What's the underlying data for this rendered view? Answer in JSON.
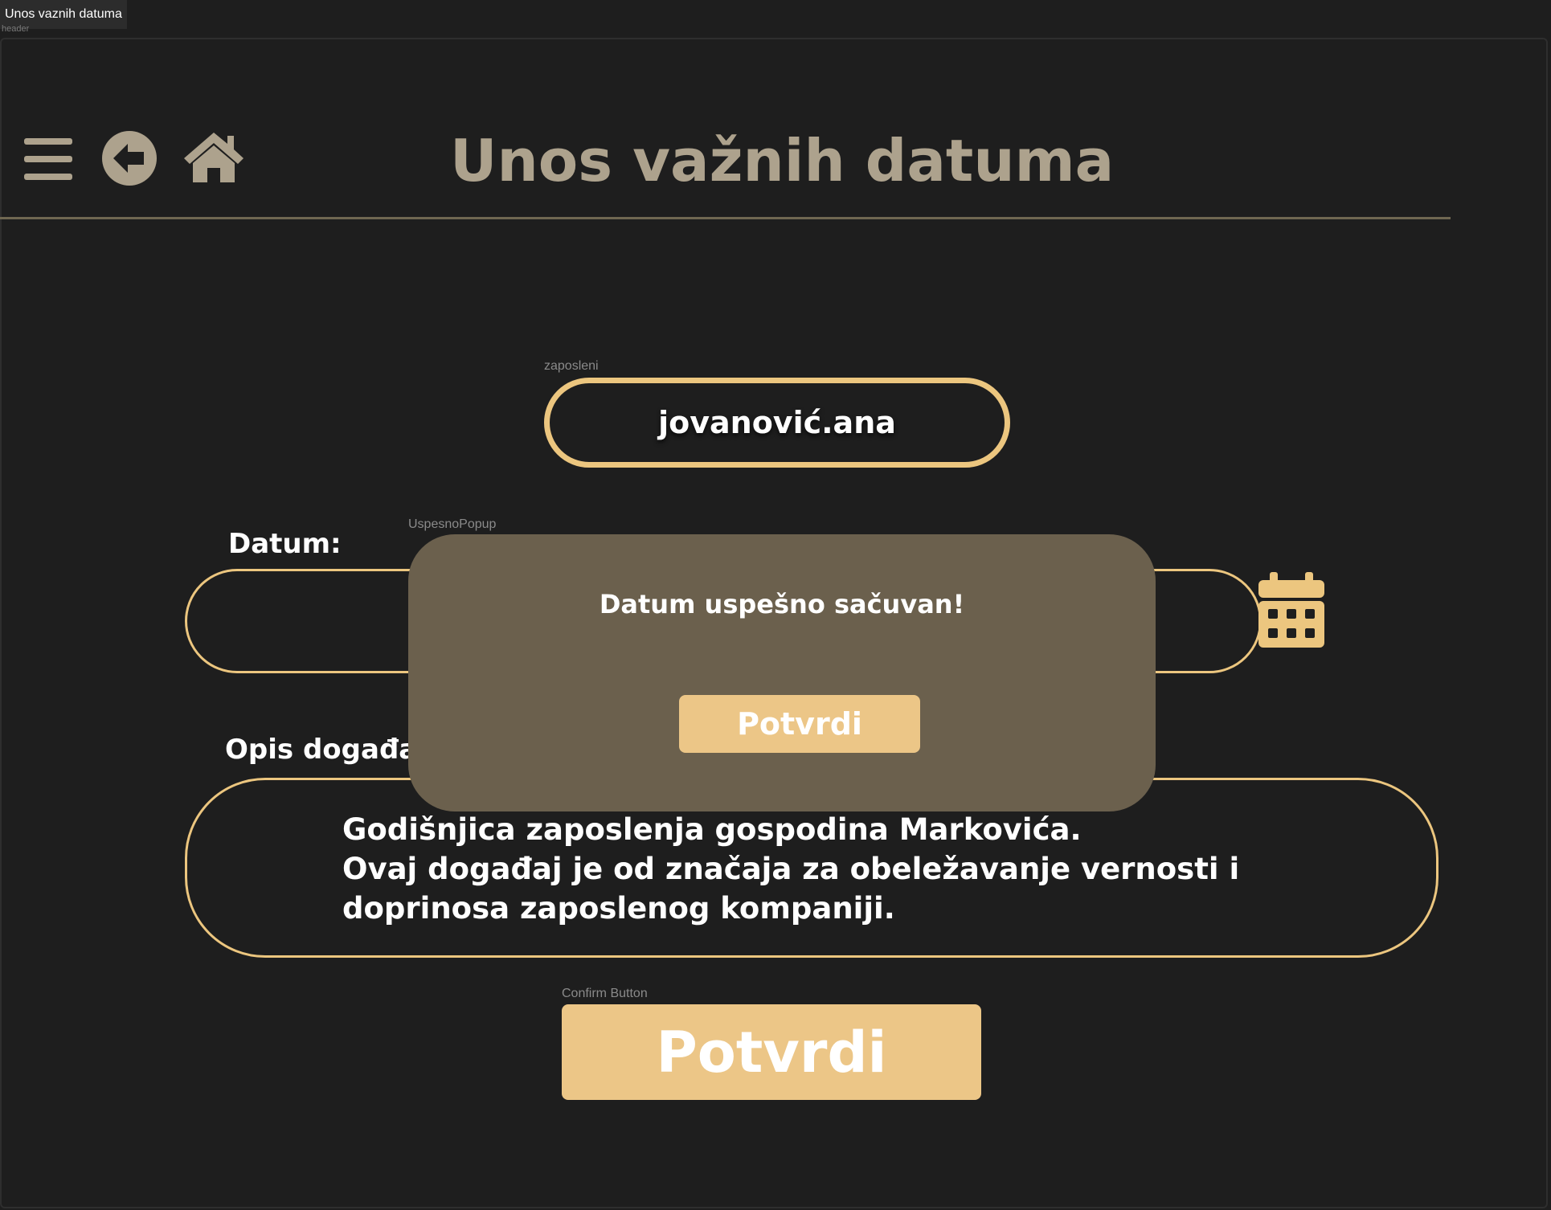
{
  "window": {
    "tab_title": "Unos vaznih datuma",
    "tab_subtitle": "header"
  },
  "header": {
    "title": "Unos važnih datuma",
    "icons": [
      "menu-icon",
      "back-arrow-icon",
      "home-icon"
    ]
  },
  "employee": {
    "frame_label": "zaposleni",
    "value": "jovanović.ana"
  },
  "date": {
    "label": "Datum:",
    "value": "",
    "icon": "calendar-icon"
  },
  "description": {
    "label": "Opis događaja:",
    "value": "Godišnjica zaposlenja gospodina Markovića.\nOvaj događaj je od značaja za obeležavanje vernosti i\ndoprinosa zaposlenog kompaniji."
  },
  "confirm": {
    "frame_label": "Confirm Button",
    "label": "Potvrdi"
  },
  "popup": {
    "frame_label": "UspesnoPopup",
    "message": "Datum uspešno sačuvan!",
    "button_label": "Potvrdi"
  },
  "colors": {
    "background": "#1e1e1e",
    "accent": "#ecc67f",
    "title": "#ada28d",
    "popup": "#6b604d"
  }
}
